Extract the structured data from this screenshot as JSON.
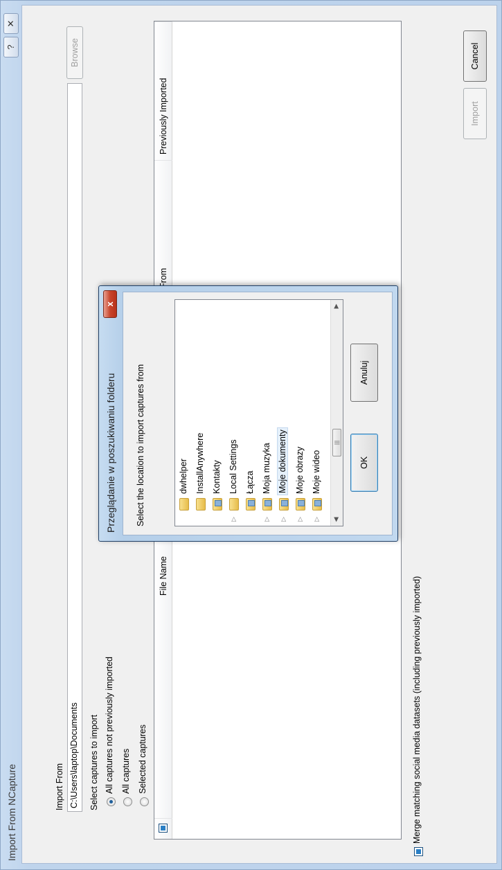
{
  "window": {
    "title": "Import From NCapture",
    "help_glyph": "?",
    "close_glyph": "✕"
  },
  "import_from": {
    "label": "Import From",
    "path_value": "C:\\Users\\laptop\\Documents",
    "browse_label": "Browse"
  },
  "selection": {
    "label": "Select captures to import",
    "options": [
      {
        "label": "All captures not previously imported",
        "selected": true
      },
      {
        "label": "All captures",
        "selected": false
      },
      {
        "label": "Selected captures",
        "selected": false
      }
    ]
  },
  "table": {
    "columns": [
      "File Name",
      "Captured From",
      "Previously Imported"
    ]
  },
  "merge_option": {
    "label": "Merge matching social media datasets (including previously imported)",
    "checked": true
  },
  "buttons": {
    "import_label": "Import",
    "cancel_label": "Cancel"
  },
  "folder_dialog": {
    "title": "Przeglądanie w poszukiwaniu folderu",
    "close_glyph": "x",
    "prompt": "Select the location to import captures from",
    "items": [
      {
        "label": "dwhelper",
        "expandable": false
      },
      {
        "label": "InstallAnywhere",
        "expandable": false
      },
      {
        "label": "Kontakty",
        "expandable": false
      },
      {
        "label": "Local Settings",
        "expandable": true
      },
      {
        "label": "Łącza",
        "expandable": false
      },
      {
        "label": "Moja muzyka",
        "expandable": true
      },
      {
        "label": "Moje dokumenty",
        "expandable": true
      },
      {
        "label": "Moje obrazy",
        "expandable": true
      },
      {
        "label": "Moje wideo",
        "expandable": true
      }
    ],
    "scroll_left_glyph": "◀",
    "scroll_thumb_glyph": "|||",
    "scroll_right_glyph": "▶",
    "ok_label": "OK",
    "cancel_label": "Anuluj"
  }
}
